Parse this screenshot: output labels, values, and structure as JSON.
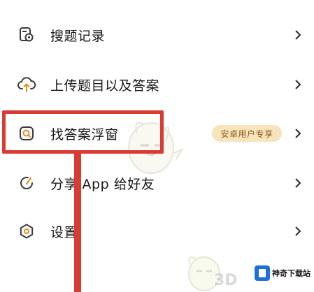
{
  "menu": {
    "items": [
      {
        "label": "搜题记录",
        "icon": "search-history-icon"
      },
      {
        "label": "上传题目以及答案",
        "icon": "cloud-upload-icon"
      },
      {
        "label": "找答案浮窗",
        "icon": "floating-window-icon",
        "badge": "安卓用户专享"
      },
      {
        "label": "分享 App 给好友",
        "icon": "share-icon"
      },
      {
        "label": "设置",
        "icon": "gear-icon"
      }
    ]
  },
  "watermark": {
    "site": "神奇下载站",
    "extra": "3D"
  },
  "colors": {
    "highlight": "#d93a32",
    "badge_bg": "#f7e4bd",
    "badge_text": "#8a5a1a",
    "text": "#1a1a1a",
    "icon": "#3a3a3a",
    "accent_orange": "#f08a1e",
    "logo_blue": "#1f6fd8"
  }
}
